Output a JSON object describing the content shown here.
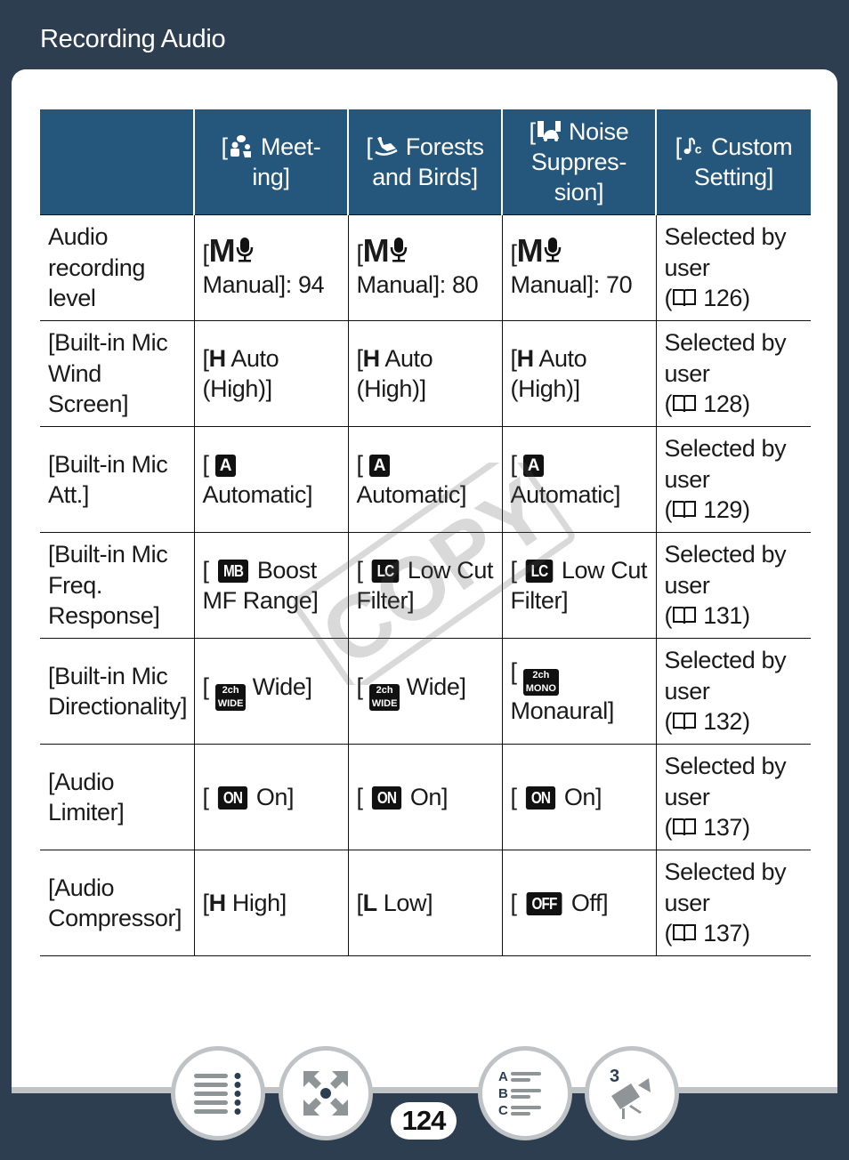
{
  "header": {
    "title": "Recording Audio"
  },
  "table": {
    "columns": [
      {
        "icon": "meeting-icon",
        "label": "Meet-\ning]",
        "prefix": "["
      },
      {
        "icon": "forests-birds-icon",
        "label": "Forests\nand Birds]",
        "prefix": "["
      },
      {
        "icon": "noise-suppression-icon",
        "label": "Noise\nSuppres-\nsion]",
        "prefix": "["
      },
      {
        "icon": "custom-setting-icon",
        "label": "Custom\nSetting]",
        "prefix": "["
      }
    ],
    "rows": [
      {
        "label": "Audio recording level",
        "cells": [
          {
            "prefix": "[",
            "icon_text": "M",
            "icon": "microphone-icon",
            "text": "Manual]: 94"
          },
          {
            "prefix": "[",
            "icon_text": "M",
            "icon": "microphone-icon",
            "text": "Manual]: 80"
          },
          {
            "prefix": "[",
            "icon_text": "M",
            "icon": "microphone-icon",
            "text": "Manual]: 70"
          }
        ],
        "custom": {
          "text": "Selected by user",
          "page": "126"
        }
      },
      {
        "label": "[Built-in Mic Wind Screen]",
        "cells": [
          {
            "prefix": "[",
            "bold": "H",
            "text": " Auto (High)]"
          },
          {
            "prefix": "[",
            "bold": "H",
            "text": " Auto (High)]"
          },
          {
            "prefix": "[",
            "bold": "H",
            "text": " Auto (High)]"
          }
        ],
        "custom": {
          "text": "Selected by user",
          "page": "128"
        }
      },
      {
        "label": "[Built-in Mic Att.]",
        "cells": [
          {
            "prefix": "[",
            "badge": "A",
            "text": "Automatic]"
          },
          {
            "prefix": "[",
            "badge": "A",
            "text": "Automatic]"
          },
          {
            "prefix": "[",
            "badge": "A",
            "text": "Automatic]"
          }
        ],
        "custom": {
          "text": "Selected by user",
          "page": "129"
        }
      },
      {
        "label": "[Built-in Mic Freq. Response]",
        "cells": [
          {
            "prefix": "[",
            "badge": "MB",
            "text": "Boost MF Range]"
          },
          {
            "prefix": "[",
            "badge": "LC",
            "text": "Low Cut Filter]"
          },
          {
            "prefix": "[",
            "badge": "LC",
            "text": "Low Cut Filter]"
          }
        ],
        "custom": {
          "text": "Selected by user",
          "page": "131"
        }
      },
      {
        "label": "[Built-in Mic Directionality]",
        "cells": [
          {
            "prefix": "[",
            "badge_top": "2ch",
            "badge_bottom": "WIDE",
            "text": "Wide]"
          },
          {
            "prefix": "[",
            "badge_top": "2ch",
            "badge_bottom": "WIDE",
            "text": "Wide]"
          },
          {
            "prefix": "[",
            "badge_top": "2ch",
            "badge_bottom": "MONO",
            "text": "Monaural]"
          }
        ],
        "custom": {
          "text": "Selected by user",
          "page": "132"
        }
      },
      {
        "label": "[Audio Limiter]",
        "cells": [
          {
            "prefix": "[",
            "badge": "ON",
            "text": "On]"
          },
          {
            "prefix": "[",
            "badge": "ON",
            "text": "On]"
          },
          {
            "prefix": "[",
            "badge": "ON",
            "text": "On]"
          }
        ],
        "custom": {
          "text": "Selected by user",
          "page": "137"
        }
      },
      {
        "label": "[Audio Compressor]",
        "cells": [
          {
            "prefix": "[",
            "bold": "H",
            "text": " High]"
          },
          {
            "prefix": "[",
            "bold": "L",
            "text": " Low]"
          },
          {
            "prefix": "[",
            "badge": "OFF",
            "text": "Off]"
          }
        ],
        "custom": {
          "text": "Selected by user",
          "page": "137"
        }
      }
    ]
  },
  "watermark": "COPY",
  "footer": {
    "page_number": "124",
    "buttons": [
      {
        "name": "table-of-contents-button",
        "icon": "list-icon"
      },
      {
        "name": "basic-operations-button",
        "icon": "expand-arrows-icon"
      },
      {
        "name": "index-button",
        "icon": "abc-index-icon"
      },
      {
        "name": "chapter-button",
        "icon": "camcorder-icon",
        "chapter": "3"
      }
    ]
  },
  "colors": {
    "background": "#2d3e50",
    "table_header": "#25567b",
    "nav_ring": "#bfc3c6",
    "icon_gray": "#8f9497"
  }
}
